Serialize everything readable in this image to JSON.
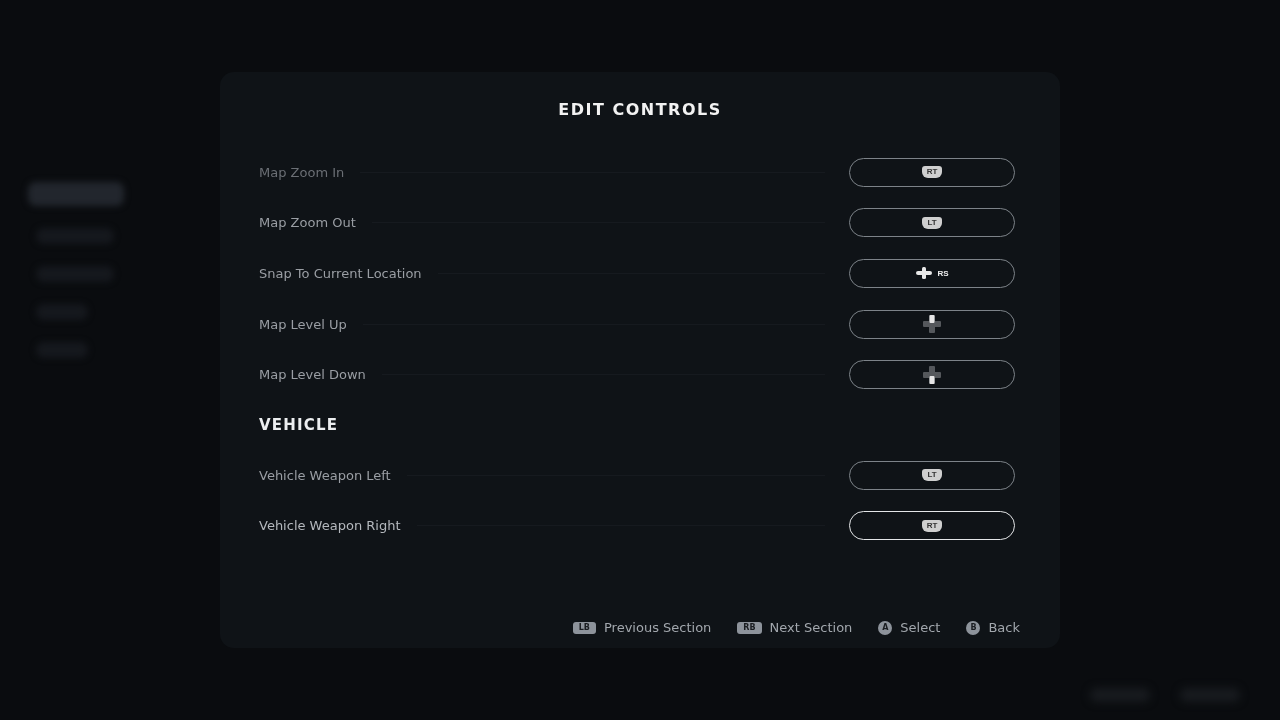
{
  "title": "EDIT CONTROLS",
  "sections": [
    {
      "rows": [
        {
          "label": "Map Zoom In",
          "selected": false,
          "binding": {
            "kind": "trigger",
            "label": "RT"
          }
        },
        {
          "label": "Map Zoom Out",
          "selected": false,
          "binding": {
            "kind": "trigger",
            "label": "LT"
          }
        },
        {
          "label": "Snap To Current Location",
          "selected": false,
          "binding": {
            "kind": "stick",
            "label": "RS"
          }
        },
        {
          "label": "Map Level Up",
          "selected": false,
          "binding": {
            "kind": "dpad",
            "up": true
          }
        },
        {
          "label": "Map Level Down",
          "selected": false,
          "binding": {
            "kind": "dpad",
            "up": false
          }
        }
      ]
    },
    {
      "heading": "VEHICLE",
      "rows": [
        {
          "label": "Vehicle Weapon Left",
          "selected": false,
          "binding": {
            "kind": "trigger",
            "label": "LT"
          }
        },
        {
          "label": "Vehicle Weapon Right",
          "selected": true,
          "binding": {
            "kind": "trigger",
            "label": "RT"
          }
        }
      ]
    }
  ],
  "hints": [
    {
      "kind": "bumper",
      "key": "LB",
      "label": "Previous Section"
    },
    {
      "kind": "bumper",
      "key": "RB",
      "label": "Next Section"
    },
    {
      "kind": "face",
      "key": "A",
      "label": "Select"
    },
    {
      "kind": "face",
      "key": "B",
      "label": "Back"
    }
  ]
}
